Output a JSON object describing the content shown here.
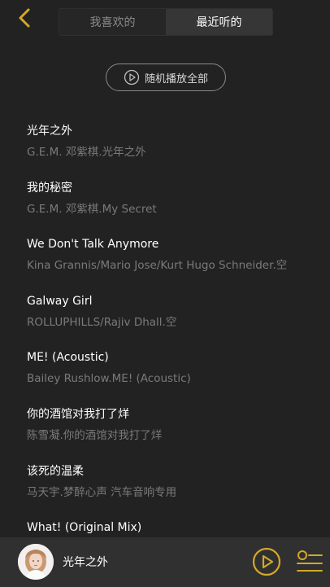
{
  "header": {
    "tabs": [
      {
        "label": "我喜欢的",
        "active": false
      },
      {
        "label": "最近听的",
        "active": true
      }
    ]
  },
  "shuffle": {
    "label": "随机播放全部"
  },
  "songs": [
    {
      "title": "光年之外",
      "subtitle": "G.E.M. 邓紫棋.光年之外"
    },
    {
      "title": "我的秘密",
      "subtitle": "G.E.M. 邓紫棋.My Secret"
    },
    {
      "title": "We Don't Talk Anymore",
      "subtitle": "Kina Grannis/Mario Jose/Kurt Hugo Schneider.空"
    },
    {
      "title": "Galway Girl",
      "subtitle": "ROLLUPHILLS/Rajiv Dhall.空"
    },
    {
      "title": "ME! (Acoustic)",
      "subtitle": "Bailey Rushlow.ME! (Acoustic)"
    },
    {
      "title": "你的酒馆对我打了烊",
      "subtitle": "陈雪凝.你的酒馆对我打了烊"
    },
    {
      "title": "该死的温柔",
      "subtitle": "马天宇.梦醉心声 汽车音响专用"
    },
    {
      "title": "What! (Original Mix)",
      "subtitle": ""
    }
  ],
  "player": {
    "now_playing": "光年之外"
  },
  "colors": {
    "accent": "#d4a72c",
    "background": "#222222",
    "player_bar": "#303030"
  },
  "icons": {
    "back": "chevron-left-icon",
    "shuffle": "play-circle-icon",
    "play": "play-circle-icon",
    "playlist": "playlist-icon"
  }
}
